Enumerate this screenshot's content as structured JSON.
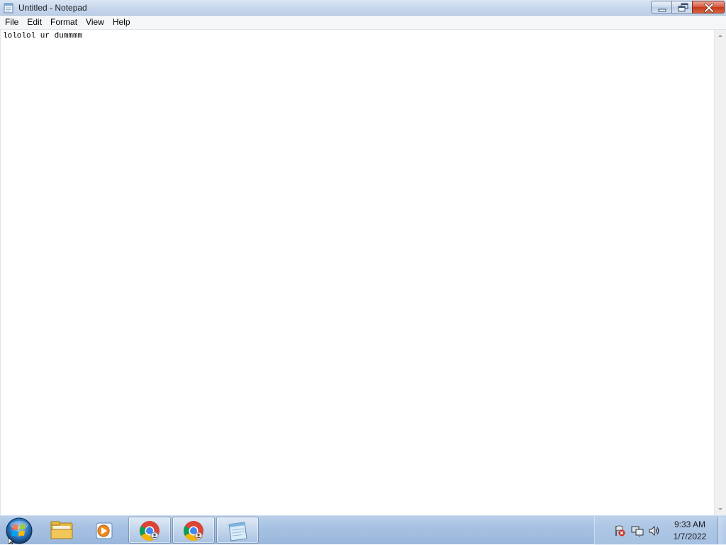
{
  "window": {
    "title": "Untitled - Notepad",
    "buttons": [
      "minimize",
      "restore",
      "close"
    ]
  },
  "menu": {
    "items": [
      "File",
      "Edit",
      "Format",
      "View",
      "Help"
    ]
  },
  "editor": {
    "content": "lololol ur dummmm"
  },
  "taskbar": {
    "start": "start-orb-icon",
    "items": [
      {
        "name": "windows-explorer",
        "icon": "folder-icon",
        "active": false
      },
      {
        "name": "media-player",
        "icon": "media-player-icon",
        "active": false
      },
      {
        "name": "chrome-1",
        "icon": "chrome-icon",
        "active": true
      },
      {
        "name": "chrome-2",
        "icon": "chrome-icon",
        "active": true
      },
      {
        "name": "notepad",
        "icon": "notepad-icon",
        "active": true
      }
    ],
    "tray_icons": [
      "action-center-flag-icon",
      "network-icon",
      "volume-icon"
    ],
    "clock": {
      "time": "9:33 AM",
      "date": "1/7/2022"
    }
  },
  "colors": {
    "titlebar": "#c6d6ec",
    "close_button": "#d6553a",
    "taskbar": "#a6c1e2"
  }
}
